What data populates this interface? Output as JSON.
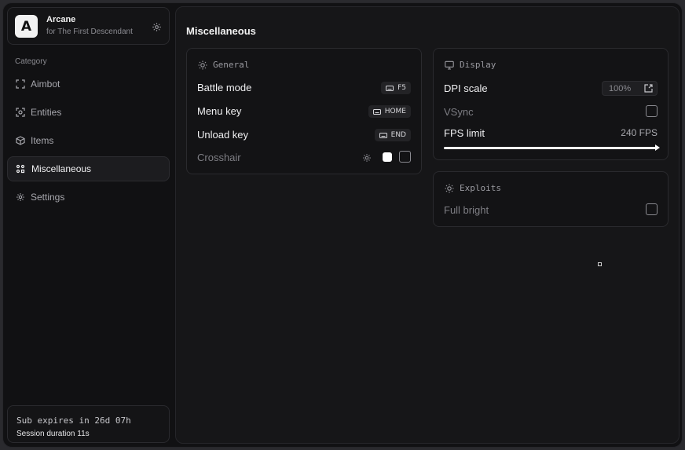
{
  "brand": {
    "logo_letter": "A",
    "name": "Arcane",
    "subtitle": "for The First Descendant",
    "icon": "gear-icon"
  },
  "sidebar": {
    "category_label": "Category",
    "items": [
      {
        "label": "Aimbot",
        "icon": "crosshair-icon",
        "active": false
      },
      {
        "label": "Entities",
        "icon": "scan-icon",
        "active": false
      },
      {
        "label": "Items",
        "icon": "cube-icon",
        "active": false
      },
      {
        "label": "Miscellaneous",
        "icon": "grid-icon",
        "active": true
      },
      {
        "label": "Settings",
        "icon": "gear-icon",
        "active": false
      }
    ]
  },
  "subscription": {
    "expires": "Sub expires in 26d 07h",
    "session": "Session duration 11s"
  },
  "main": {
    "title": "Miscellaneous",
    "general": {
      "title": "General",
      "rows": [
        {
          "label": "Battle mode",
          "key": "F5"
        },
        {
          "label": "Menu key",
          "key": "HOME"
        },
        {
          "label": "Unload key",
          "key": "END"
        }
      ],
      "crosshair_label": "Crosshair",
      "crosshair_color": "#ffffff",
      "crosshair_enabled": false
    },
    "display": {
      "title": "Display",
      "dpi_label": "DPI scale",
      "dpi_value": "100%",
      "vsync_label": "VSync",
      "vsync_enabled": false,
      "fps_label": "FPS limit",
      "fps_value": "240 FPS",
      "fps_fill": 1.0
    },
    "exploits": {
      "title": "Exploits",
      "fullbright_label": "Full bright",
      "fullbright_enabled": false
    }
  }
}
